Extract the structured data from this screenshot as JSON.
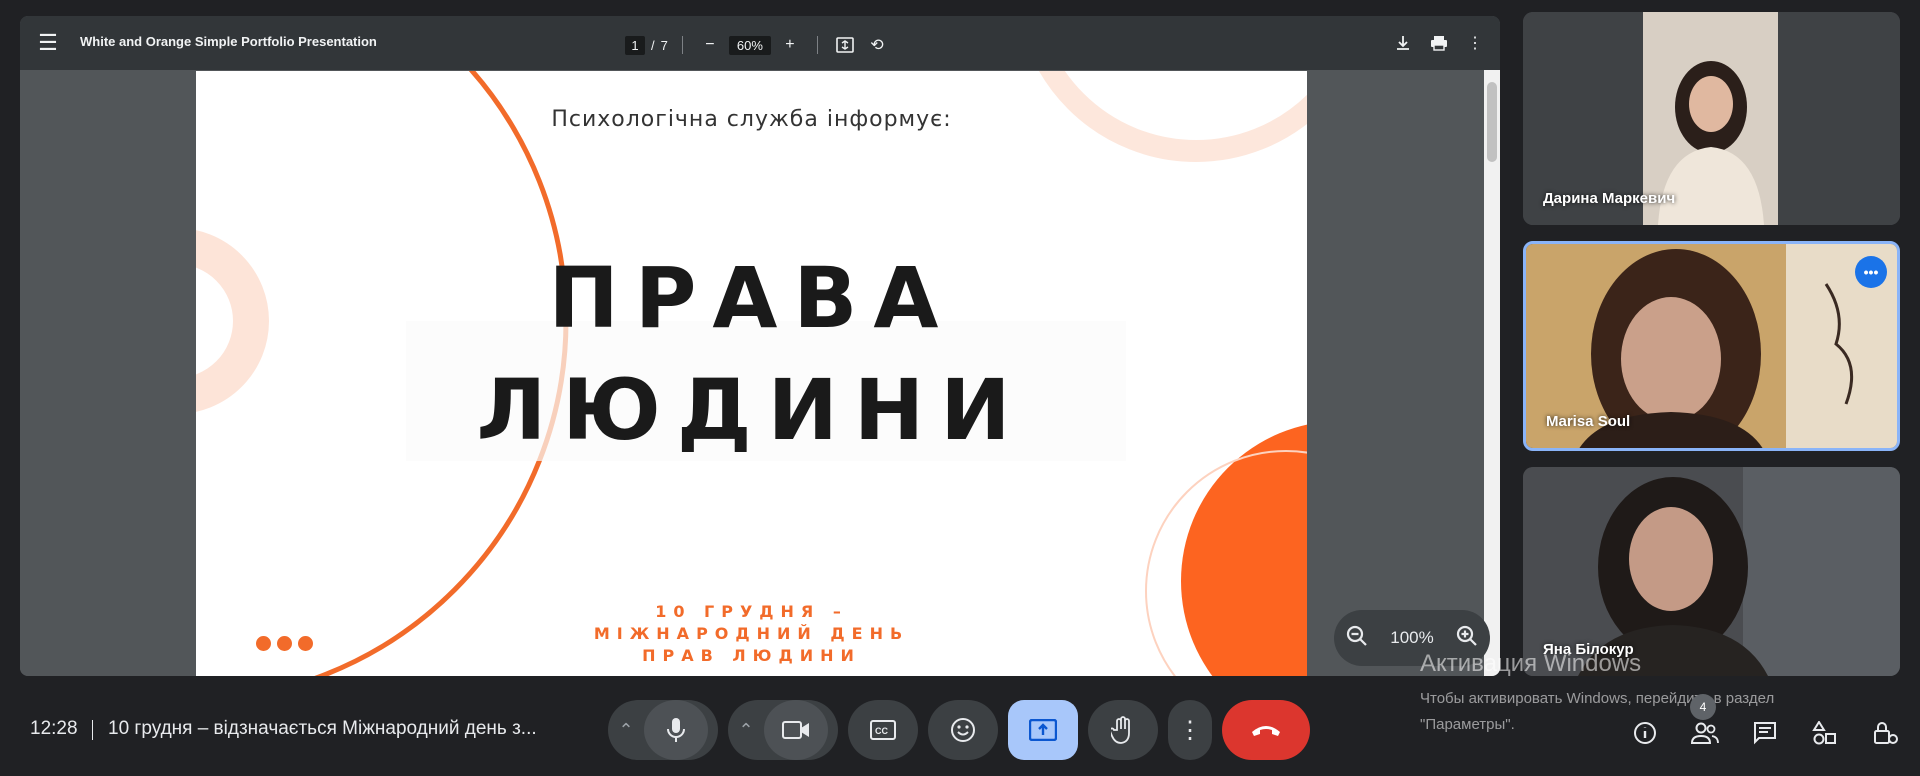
{
  "pdf": {
    "title": "White and Orange Simple Portfolio Presentation",
    "page_current": "1",
    "page_sep": "/",
    "page_total": "7",
    "zoom": "60%",
    "icons": [
      "menu-icon",
      "minus-icon",
      "plus-icon",
      "fit-page-icon",
      "rotate-icon",
      "download-icon",
      "print-icon",
      "more-vert-icon"
    ]
  },
  "slide": {
    "subtitle": "Психологічна служба інформує:",
    "title_line1": "ПРАВА",
    "title_line2": "ЛЮДИНИ",
    "footer_line1": "10 ГРУДНЯ –",
    "footer_line2": "МІЖНАРОДНИЙ ДЕНЬ",
    "footer_line3": "ПРАВ ЛЮДИНИ",
    "accent_color": "#f26b2a"
  },
  "zoom_overlay": {
    "value": "100%"
  },
  "participants": [
    {
      "name": "Дарина Маркевич"
    },
    {
      "name": "Marisa Soul",
      "active": true
    },
    {
      "name": "Яна Білокур"
    }
  ],
  "bottom": {
    "time": "12:28",
    "meeting_title": "10 грудня – відзначається Міжнародний день з...",
    "people_count": "4"
  },
  "watermark": {
    "heading": "Активация Windows",
    "line1": "Чтобы активировать Windows, перейдите в раздел",
    "line2": "\"Параметры\"."
  }
}
